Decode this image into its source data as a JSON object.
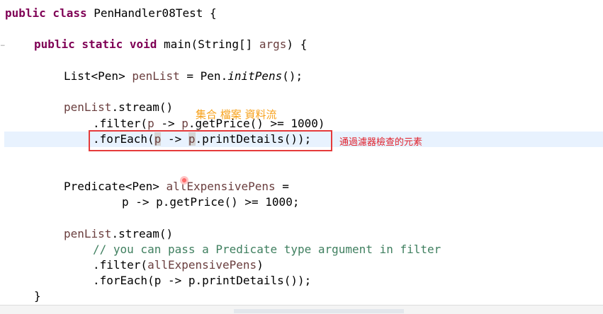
{
  "code": {
    "class_decl": [
      "public class",
      " PenHandler08Test {"
    ],
    "main_decl": [
      "public static void",
      " main(String[] ",
      "args",
      ") {"
    ],
    "list_line": [
      "List<Pen> ",
      "penList",
      " = Pen.",
      "initPens",
      "();"
    ],
    "stream1": [
      "penList",
      ".stream()"
    ],
    "filter1": [
      ".filter(",
      "p",
      " -> ",
      "p",
      ".getPrice() >= 1000)"
    ],
    "foreach1": [
      ".forEach(",
      "p",
      " -> ",
      "p",
      ".printDetails());"
    ],
    "pred_line": [
      "Predicate<Pen> ",
      "allExpensivePens",
      " ="
    ],
    "pred_body": [
      "p -> p.getPrice() >= 1000;"
    ],
    "stream2": [
      "penList",
      ".stream()"
    ],
    "comment": "// you can pass a Predicate type argument in filter",
    "filter2": [
      ".filter(",
      "allExpensivePens",
      ")"
    ],
    "foreach2": [
      ".forEach(p -> p.printDetails());"
    ],
    "close_brace": "}"
  },
  "annotations": {
    "orange_note": "集合 檔案 資料流",
    "red_callout": "通過濾器檢查的元素",
    "fold_marker": "−"
  },
  "colors": {
    "keyword": "#7f0055",
    "field": "#0000c0",
    "local": "#6a3e3e",
    "comment": "#3f7f5f",
    "callout_red": "#e53b3b",
    "note_orange": "#f7a21c",
    "current_line": "#e8f2fe"
  }
}
